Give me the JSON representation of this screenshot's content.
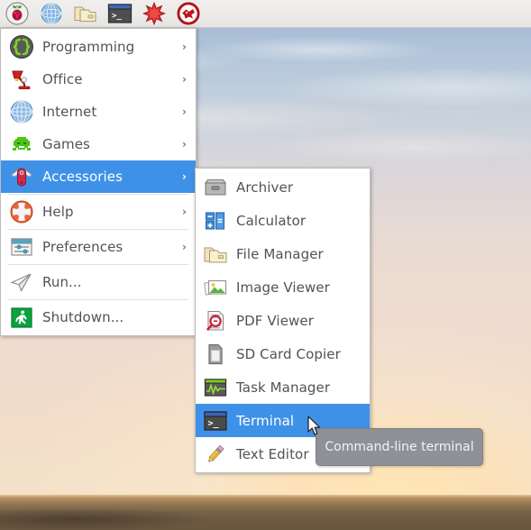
{
  "panel": {
    "items": [
      {
        "name": "raspberry-menu-button",
        "label": "Raspberry Pi Menu",
        "icon": "raspberry-icon"
      },
      {
        "name": "web-browser-button",
        "label": "Web Browser",
        "icon": "globe-icon"
      },
      {
        "name": "file-manager-button",
        "label": "File Manager",
        "icon": "folder-icon"
      },
      {
        "name": "terminal-button",
        "label": "Terminal",
        "icon": "terminal-icon"
      },
      {
        "name": "mathematica-button",
        "label": "Mathematica",
        "icon": "starburst-icon"
      },
      {
        "name": "wolfram-button",
        "label": "Wolfram",
        "icon": "wolfram-icon"
      }
    ]
  },
  "main_menu": {
    "items": [
      {
        "label": "Programming",
        "icon": "braces-icon",
        "arrow": "›",
        "selected": false,
        "separator_after": false
      },
      {
        "label": "Office",
        "icon": "desk-lamp-icon",
        "arrow": "›",
        "selected": false,
        "separator_after": false
      },
      {
        "label": "Internet",
        "icon": "globe-icon",
        "arrow": "›",
        "selected": false,
        "separator_after": false
      },
      {
        "label": "Games",
        "icon": "space-invader-icon",
        "arrow": "›",
        "selected": false,
        "separator_after": false
      },
      {
        "label": "Accessories",
        "icon": "swiss-knife-icon",
        "arrow": "›",
        "selected": true,
        "separator_after": true
      },
      {
        "label": "Help",
        "icon": "lifebuoy-icon",
        "arrow": "›",
        "selected": false,
        "separator_after": true
      },
      {
        "label": "Preferences",
        "icon": "sliders-icon",
        "arrow": "›",
        "selected": false,
        "separator_after": true
      },
      {
        "label": "Run...",
        "icon": "paper-plane-icon",
        "arrow": "",
        "selected": false,
        "separator_after": true
      },
      {
        "label": "Shutdown...",
        "icon": "exit-runner-icon",
        "arrow": "",
        "selected": false,
        "separator_after": false
      }
    ]
  },
  "sub_menu": {
    "parent": "Accessories",
    "items": [
      {
        "label": "Archiver",
        "icon": "archive-box-icon",
        "selected": false
      },
      {
        "label": "Calculator",
        "icon": "calculator-icon",
        "selected": false
      },
      {
        "label": "File Manager",
        "icon": "folder-icon",
        "selected": false
      },
      {
        "label": "Image Viewer",
        "icon": "photo-icon",
        "selected": false
      },
      {
        "label": "PDF Viewer",
        "icon": "pdf-magnifier-icon",
        "selected": false
      },
      {
        "label": "SD Card Copier",
        "icon": "sd-card-icon",
        "selected": false
      },
      {
        "label": "Task Manager",
        "icon": "task-monitor-icon",
        "selected": false
      },
      {
        "label": "Terminal",
        "icon": "terminal-icon",
        "selected": true
      },
      {
        "label": "Text Editor",
        "icon": "pencil-icon",
        "selected": false
      }
    ]
  },
  "tooltip": {
    "text": "Command-line terminal"
  },
  "colors": {
    "selection": "#3f91e8",
    "panel_bg": "#ecebe9",
    "menu_bg": "#ffffff",
    "menu_text": "#4f5356",
    "tooltip_bg": "#8e9296",
    "tooltip_text": "#f2f3f4"
  }
}
